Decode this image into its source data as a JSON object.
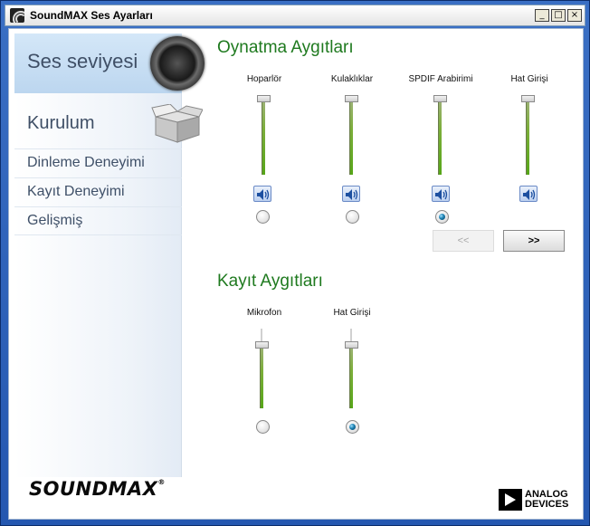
{
  "window": {
    "title": "SoundMAX Ses Ayarları",
    "controls": [
      "_",
      "□",
      "×"
    ]
  },
  "sidebar": {
    "volume_label": "Ses seviyesi",
    "setup_label": "Kurulum",
    "links": [
      "Dinleme Deneyimi",
      "Kayıt Deneyimi",
      "Gelişmiş"
    ]
  },
  "playback": {
    "title": "Oynatma Aygıtları",
    "devices": [
      {
        "name": "Hoparlör",
        "selected": false,
        "level": 1.0
      },
      {
        "name": "Kulaklıklar",
        "selected": false,
        "level": 1.0
      },
      {
        "name": "SPDIF Arabirimi",
        "selected": true,
        "level": 1.0
      },
      {
        "name": "Hat Girişi",
        "selected": false,
        "level": 1.0
      }
    ],
    "prev_label": "<<",
    "next_label": ">>"
  },
  "recording": {
    "title": "Kayıt Aygıtları",
    "devices": [
      {
        "name": "Mikrofon",
        "selected": false,
        "level": 1.0
      },
      {
        "name": "Hat Girişi",
        "selected": true,
        "level": 1.0
      }
    ]
  },
  "branding": {
    "soundmax": "SOUNDMAX",
    "reg": "®",
    "analog": "ANALOG",
    "devices": "DEVICES"
  },
  "colors": {
    "section_title": "#1f7a1f",
    "titlebar": "#ffffff",
    "frame": "#2457b0"
  }
}
